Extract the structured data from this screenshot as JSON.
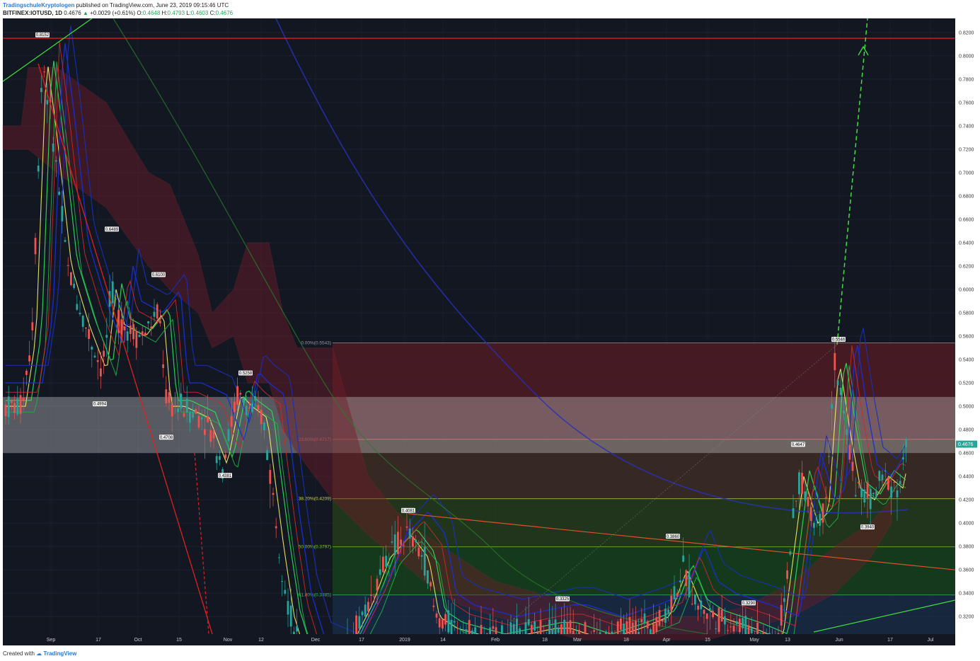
{
  "header": {
    "author": "TradingschuleKryptologen",
    "published": "published on TradingView.com, June 23, 2019 09:15:46 UTC",
    "symbol": "BITFINEX:IOTUSD, 1D",
    "last": "0.4676",
    "change_arrow": "▲",
    "change": "+0.0029 (+0.61%)",
    "o_label": "O:",
    "o": "0.4648",
    "h_label": "H:",
    "h": "0.4793",
    "l_label": "L:",
    "l": "0.4603",
    "c_label": "C:",
    "c": "0.4676"
  },
  "footer": {
    "created_with": "Created with",
    "brand": "TradingView"
  },
  "chart_data": {
    "type": "candlestick",
    "symbol": "BITFINEX:IOTUSD",
    "interval": "1D",
    "ylim": [
      0.305,
      0.832
    ],
    "y_ticks": [
      "0.8200",
      "0.8000",
      "0.7800",
      "0.7600",
      "0.7400",
      "0.7200",
      "0.7000",
      "0.6800",
      "0.6600",
      "0.6400",
      "0.6200",
      "0.6000",
      "0.5800",
      "0.5600",
      "0.5400",
      "0.5200",
      "0.5000",
      "0.4800",
      "0.4600",
      "0.4400",
      "0.4200",
      "0.4000",
      "0.3800",
      "0.3600",
      "0.3400",
      "0.3200"
    ],
    "x_ticks": [
      "Sep",
      "17",
      "Oct",
      "15",
      "Nov",
      "12",
      "Dec",
      "17",
      "2019",
      "14",
      "Feb",
      "18",
      "Mar",
      "18",
      "Apr",
      "15",
      "May",
      "13",
      "Jun",
      "17",
      "Jul"
    ],
    "last_price_label": "0.4676",
    "colors": {
      "background": "#131722",
      "up": "#26a69a",
      "down": "#ef5350",
      "resistance": "#ff2020",
      "fib_top": "#4a1820",
      "fib_mid": "#24301c",
      "fib_low": "#163318"
    },
    "horizontal_lines": [
      {
        "price": 0.815,
        "color": "#ff2020"
      }
    ],
    "fibonacci": [
      {
        "label": "0.00%(0.5543)",
        "price": 0.5543,
        "color": "#9a9a9a"
      },
      {
        "label": "23.60%(0.4717)",
        "price": 0.4717,
        "color": "#ef5350"
      },
      {
        "label": "38.20%(0.4209)",
        "price": 0.4209,
        "color": "#c8d64a"
      },
      {
        "label": "50.00%(0.3797)",
        "price": 0.3797,
        "color": "#7ecb3d"
      },
      {
        "label": "61.80%(0.3385)",
        "price": 0.3385,
        "color": "#3fbf6a"
      }
    ],
    "support_zone": [
      0.46,
      0.508
    ],
    "price_labels": [
      {
        "text": "0.8152",
        "price": 0.8152
      },
      {
        "text": "0.6489",
        "price": 0.6489
      },
      {
        "text": "0.6100",
        "price": 0.61
      },
      {
        "text": "0.4994",
        "price": 0.4994
      },
      {
        "text": "0.4708",
        "price": 0.4708
      },
      {
        "text": "0.5258",
        "price": 0.5258
      },
      {
        "text": "0.4381",
        "price": 0.4381
      },
      {
        "text": "0.4081",
        "price": 0.4081
      },
      {
        "text": "0.3325",
        "price": 0.3325
      },
      {
        "text": "0.3860",
        "price": 0.386
      },
      {
        "text": "0.3290",
        "price": 0.329
      },
      {
        "text": "0.4647",
        "price": 0.4647
      },
      {
        "text": "0.5546",
        "price": 0.5546
      },
      {
        "text": "0.3940",
        "price": 0.394
      }
    ]
  }
}
